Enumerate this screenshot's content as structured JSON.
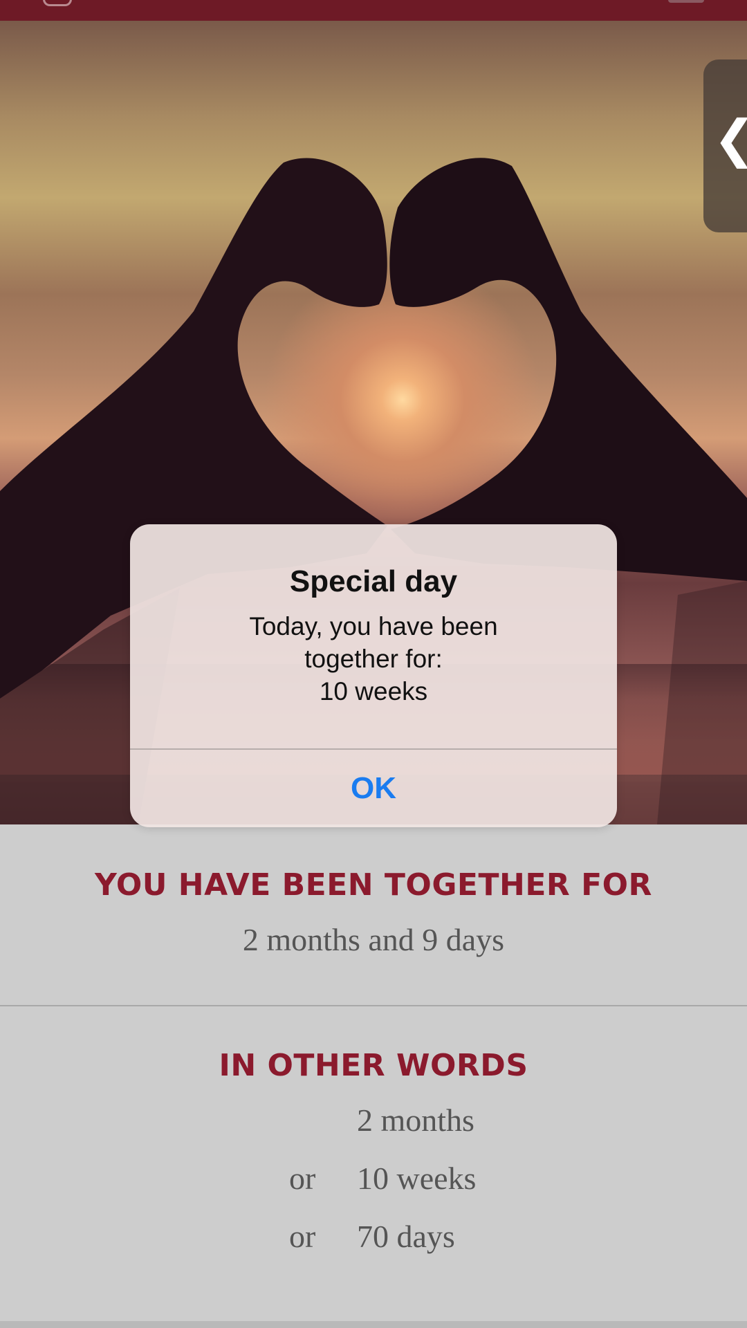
{
  "nav": {
    "title_fragment": "",
    "left_icon": "heart-outline-icon",
    "right_icon": "menu-icon"
  },
  "hero": {
    "image": "heart-hands-sunset-photo"
  },
  "side_tab": {
    "chevron": "❮",
    "icon": "chevron-left-icon"
  },
  "together": {
    "heading": "YOU HAVE BEEN TOGETHER FOR",
    "duration": "2 months and 9 days"
  },
  "other_words": {
    "heading": "IN OTHER WORDS",
    "rows": [
      {
        "prefix": "",
        "value": "2 months"
      },
      {
        "prefix": "or",
        "value": "10 weeks"
      },
      {
        "prefix": "or",
        "value": "70 days"
      }
    ]
  },
  "alert": {
    "title": "Special day",
    "message_lines": [
      "Today, you have been",
      "together for:",
      "10 weeks"
    ],
    "button_label": "OK"
  },
  "colors": {
    "nav_bar": "#6e1a26",
    "heading_red": "#8b1a2d",
    "body_gray": "#555555",
    "background": "#cdcdcd",
    "ios_blue": "#1a7cf0"
  }
}
